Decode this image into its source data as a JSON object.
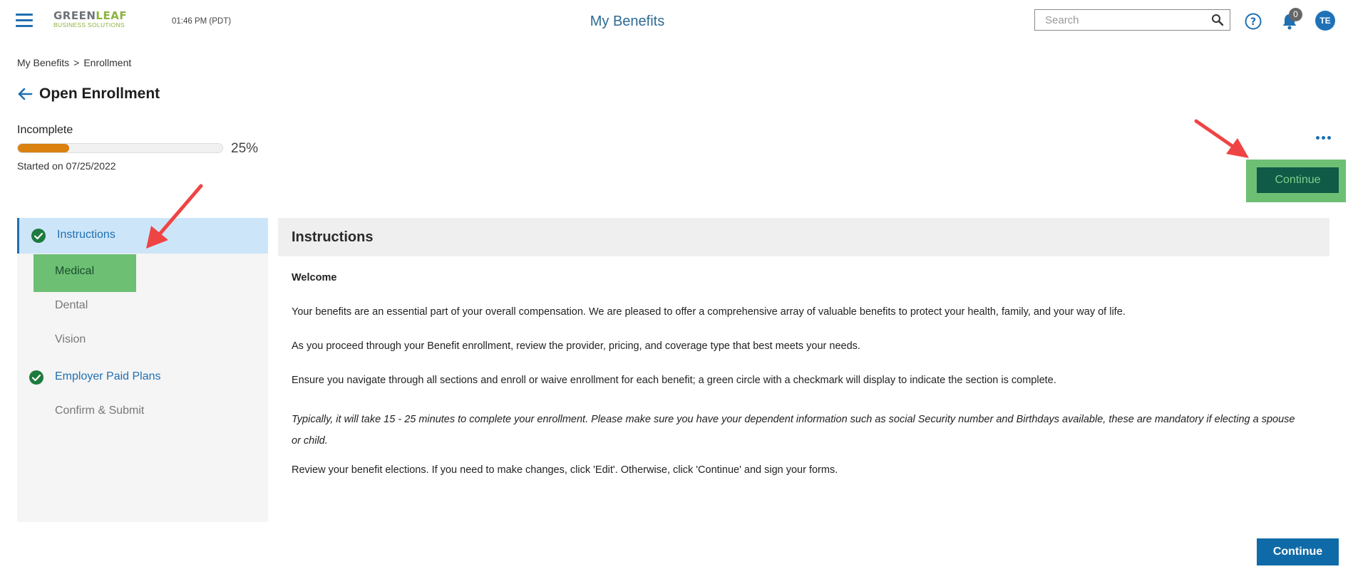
{
  "header": {
    "logo_top": "GREEN",
    "logo_leaf": "LEAF",
    "logo_bottom": "BUSINESS SOLUTIONS",
    "time": "01:46 PM (PDT)",
    "app_title": "My Benefits",
    "search_placeholder": "Search",
    "notification_count": "0",
    "avatar_initials": "TE"
  },
  "breadcrumb": {
    "root": "My Benefits",
    "separator": ">",
    "current": "Enrollment"
  },
  "page": {
    "title": "Open Enrollment",
    "status": "Incomplete",
    "progress_percent": 25,
    "progress_label": "25%",
    "started": "Started on 07/25/2022"
  },
  "actions": {
    "continue_top": "Continue",
    "continue_bottom": "Continue"
  },
  "sidebar": {
    "items": [
      {
        "label": "Instructions",
        "state": "complete-active"
      },
      {
        "label": "Medical",
        "state": "highlighted"
      },
      {
        "label": "Dental",
        "state": "pending"
      },
      {
        "label": "Vision",
        "state": "pending"
      },
      {
        "label": "Employer Paid Plans",
        "state": "complete"
      },
      {
        "label": "Confirm & Submit",
        "state": "pending"
      }
    ]
  },
  "content": {
    "heading": "Instructions",
    "welcome": "Welcome",
    "p1": "Your benefits are an essential part of your overall compensation. We are pleased to offer a comprehensive array of valuable benefits to protect your health, family, and your way of life.",
    "p2": "As you proceed through your Benefit enrollment, review the provider, pricing, and coverage type that best meets your needs.",
    "p3": "Ensure you navigate through all sections and enroll or waive enrollment for each benefit; a green circle with a checkmark will display to indicate the section is complete.",
    "p4": "Typically, it will take 15 - 25 minutes to complete your enrollment. Please make sure you have your dependent information such as social Security number and Birthdays available, these are mandatory if electing a spouse or child.",
    "p5": "Review your benefit elections. If you need to make changes, click 'Edit'. Otherwise, click 'Continue' and sign your forms."
  },
  "colors": {
    "brand_blue": "#1f6fb2",
    "progress_orange": "#d98111",
    "check_green": "#1e7a3e",
    "highlight_green": "#6dbf74",
    "annotation_red": "#ef4444"
  },
  "icons": [
    "menu-icon",
    "search-icon",
    "help-icon",
    "bell-icon",
    "back-arrow-icon",
    "check-circle-icon",
    "more-icon"
  ]
}
